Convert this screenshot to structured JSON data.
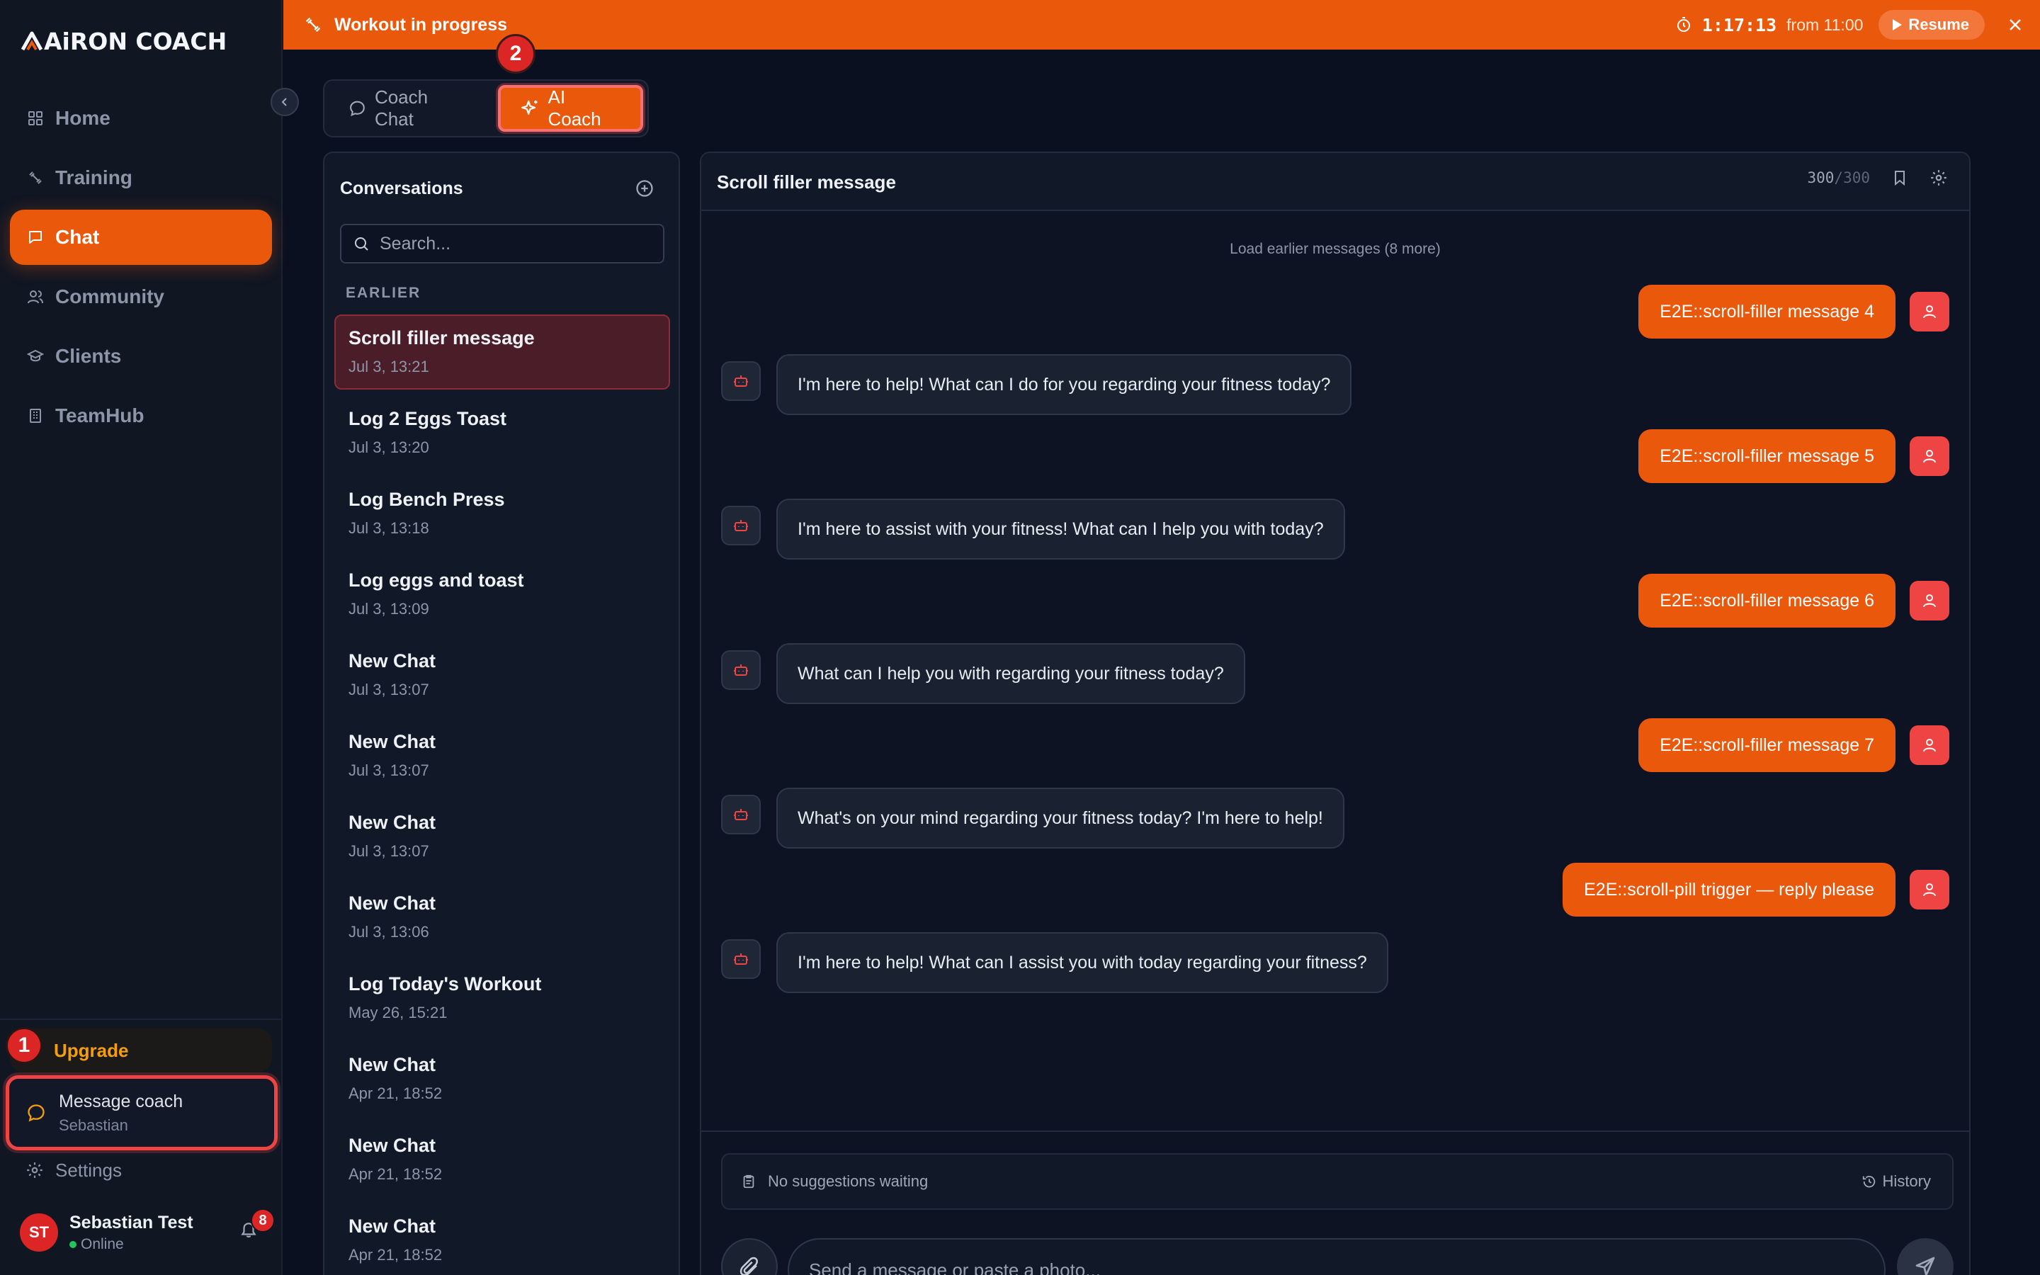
{
  "app": {
    "logo_text": "AiRON COACH",
    "accent_color": "#ea580c",
    "alert_color": "#dc2626"
  },
  "sidebar": {
    "items": [
      {
        "label": "Home",
        "icon": "grid-icon"
      },
      {
        "label": "Training",
        "icon": "dumbbell-icon"
      },
      {
        "label": "Chat",
        "icon": "chat-icon",
        "active": true
      },
      {
        "label": "Community",
        "icon": "users-icon"
      },
      {
        "label": "Clients",
        "icon": "graduation-cap-icon"
      },
      {
        "label": "TeamHub",
        "icon": "building-icon"
      }
    ],
    "upgrade_label": "Upgrade",
    "step_badge_1": "1",
    "message_coach": {
      "title": "Message coach",
      "subtitle": "Sebastian"
    },
    "settings_label": "Settings",
    "user": {
      "initials": "ST",
      "name": "Sebastian Test",
      "status": "Online",
      "notifications": "8"
    }
  },
  "banner": {
    "title": "Workout in progress",
    "timer": "1:17:13",
    "from": "from 11:00",
    "resume_label": "Resume"
  },
  "tabs": {
    "step_badge_2": "2",
    "items": [
      {
        "label": "Coach Chat",
        "active": false
      },
      {
        "label": "AI Coach",
        "active": true
      }
    ]
  },
  "conversations": {
    "title": "Conversations",
    "search_placeholder": "Search...",
    "section_label": "EARLIER",
    "items": [
      {
        "title": "Scroll filler message",
        "date": "Jul 3, 13:21",
        "selected": true
      },
      {
        "title": "Log 2 Eggs Toast",
        "date": "Jul 3, 13:20"
      },
      {
        "title": "Log Bench Press",
        "date": "Jul 3, 13:18"
      },
      {
        "title": "Log eggs and toast",
        "date": "Jul 3, 13:09"
      },
      {
        "title": "New Chat",
        "date": "Jul 3, 13:07"
      },
      {
        "title": "New Chat",
        "date": "Jul 3, 13:07"
      },
      {
        "title": "New Chat",
        "date": "Jul 3, 13:07"
      },
      {
        "title": "New Chat",
        "date": "Jul 3, 13:06"
      },
      {
        "title": "Log Today's Workout",
        "date": "May 26, 15:21"
      },
      {
        "title": "New Chat",
        "date": "Apr 21, 18:52"
      },
      {
        "title": "New Chat",
        "date": "Apr 21, 18:52"
      },
      {
        "title": "New Chat",
        "date": "Apr 21, 18:52"
      }
    ]
  },
  "chat": {
    "title": "Scroll filler message",
    "counter_used": "300",
    "counter_total": "/300",
    "load_earlier": "Load earlier messages (8 more)",
    "messages": [
      {
        "role": "user",
        "text": "E2E::scroll-filler message 4"
      },
      {
        "role": "bot",
        "text": "I'm here to help! What can I do for you regarding your fitness today?"
      },
      {
        "role": "user",
        "text": "E2E::scroll-filler message 5"
      },
      {
        "role": "bot",
        "text": "I'm here to assist with your fitness! What can I help you with today?"
      },
      {
        "role": "user",
        "text": "E2E::scroll-filler message 6"
      },
      {
        "role": "bot",
        "text": "What can I help you with regarding your fitness today?"
      },
      {
        "role": "user",
        "text": "E2E::scroll-filler message 7"
      },
      {
        "role": "bot",
        "text": "What's on your mind regarding your fitness today? I'm here to help!"
      },
      {
        "role": "user",
        "text": "E2E::scroll-pill trigger — reply please"
      },
      {
        "role": "bot",
        "text": "I'm here to help! What can I assist you with today regarding your fitness?"
      }
    ],
    "suggestions_text": "No suggestions waiting",
    "history_label": "History",
    "input_placeholder": "Send a message or paste a photo..."
  }
}
